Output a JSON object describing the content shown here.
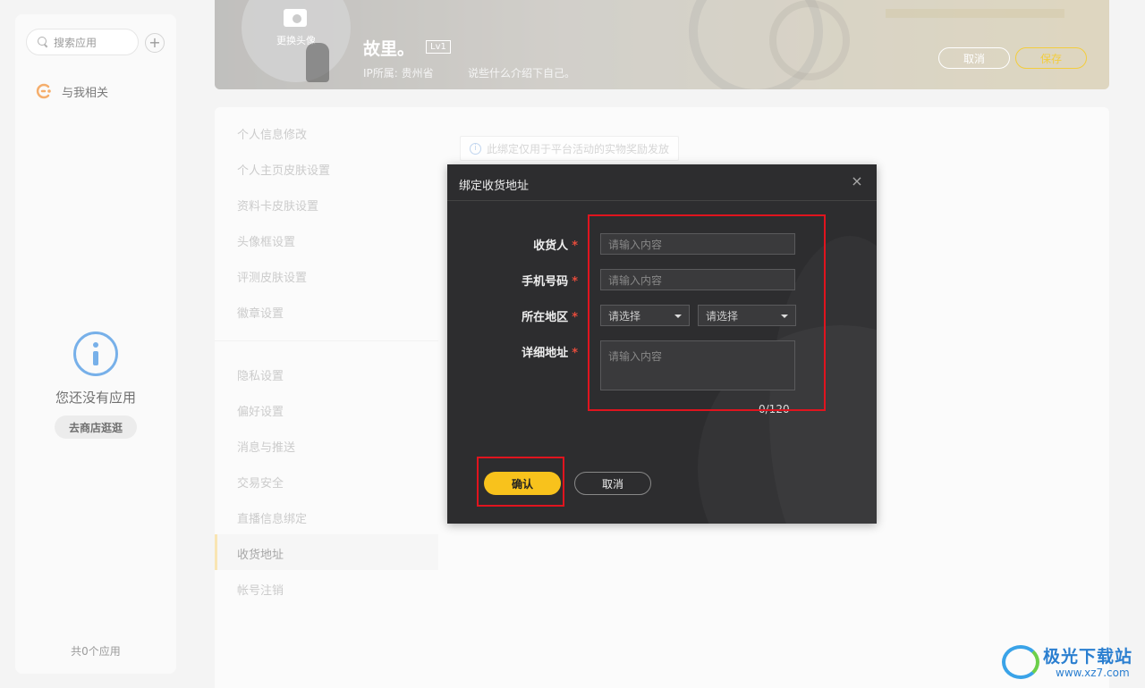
{
  "sidebar": {
    "search_placeholder": "搜索应用",
    "add_label": "+",
    "related_label": "与我相关",
    "empty_text": "您还没有应用",
    "store_button": "去商店逛逛",
    "app_count": "共0个应用"
  },
  "profile": {
    "change_avatar": "更换头像",
    "username": "故里。",
    "level": "Lv1",
    "ip_location": "IP所属: 贵州省",
    "bio_placeholder": "说些什么介绍下自己。",
    "cancel": "取消",
    "save": "保存"
  },
  "settings_menu": {
    "group1": [
      "个人信息修改",
      "个人主页皮肤设置",
      "资料卡皮肤设置",
      "头像框设置",
      "评测皮肤设置",
      "徽章设置"
    ],
    "group2": [
      "隐私设置",
      "偏好设置",
      "消息与推送",
      "交易安全",
      "直播信息绑定",
      "收货地址",
      "帐号注销"
    ],
    "active": "收货地址"
  },
  "notice": {
    "icon": "i",
    "text": "此绑定仅用于平台活动的实物奖励发放"
  },
  "dialog": {
    "title": "绑定收货地址",
    "close": "×",
    "fields": {
      "recipient": {
        "label": "收货人",
        "placeholder": "请输入内容"
      },
      "phone": {
        "label": "手机号码",
        "placeholder": "请输入内容"
      },
      "region": {
        "label": "所在地区",
        "province_placeholder": "请选择",
        "city_placeholder": "请选择"
      },
      "address": {
        "label": "详细地址",
        "placeholder": "请输入内容"
      }
    },
    "required_mark": "*",
    "char_count": "0/120",
    "confirm": "确认",
    "cancel": "取消"
  },
  "watermark": {
    "title": "极光下载站",
    "url": "www.xz7.com"
  },
  "colors": {
    "accent_yellow": "#f8c21c",
    "dialog_bg": "#2d2d2f",
    "highlight_red": "#e0141e",
    "info_blue": "#2e86de"
  }
}
